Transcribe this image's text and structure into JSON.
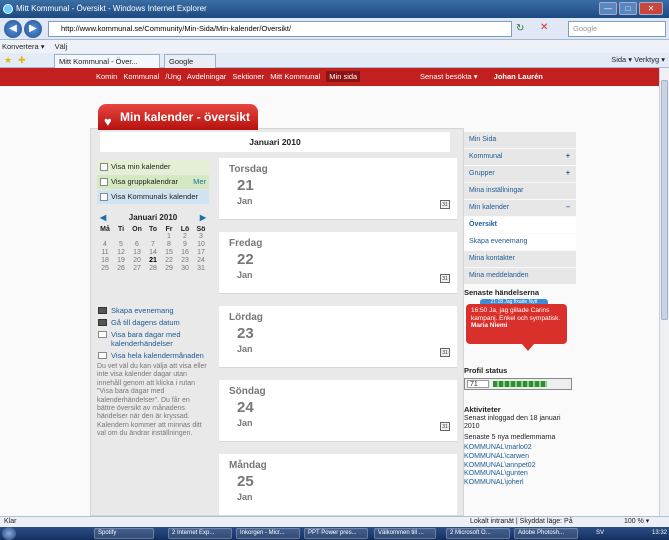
{
  "window": {
    "title": "Mitt Kommunal - Översikt - Windows Internet Explorer",
    "buttons": [
      "—",
      "□",
      "✕"
    ]
  },
  "browser": {
    "address": "http://www.kommunal.se/Community/Min-Sida/Min-kalender/Oversikt/",
    "search_placeholder": "Google",
    "toolbar": [
      "Konvertera ▾",
      "Välj"
    ],
    "tabs": [
      "Mitt Kommunal - Över...",
      "Google"
    ],
    "commands": "Sida ▾  Verktyg ▾"
  },
  "topnav": {
    "items": [
      "Komin",
      "Kommunal",
      "/Ung",
      "Avdelningar",
      "Sektioner",
      "Mitt Kommunal",
      "Min sida"
    ],
    "recent": "Senast besökta ▾",
    "user": "Johan Laurén"
  },
  "heading": "Min kalender - översikt",
  "month_title": "Januari 2010",
  "views": [
    {
      "label": "Visa min kalender",
      "extra": ""
    },
    {
      "label": "Visa gruppkalendrar",
      "extra": "Mer"
    },
    {
      "label": "Visa Kommunals kalender",
      "extra": ""
    }
  ],
  "minical": {
    "month": "Januari 2010",
    "days": [
      "Må",
      "Ti",
      "On",
      "To",
      "Fr",
      "Lö",
      "Sö"
    ],
    "cells": [
      "",
      "",
      "",
      "",
      "1",
      "2",
      "3",
      "4",
      "5",
      "6",
      "7",
      "8",
      "9",
      "10",
      "11",
      "12",
      "13",
      "14",
      "15",
      "16",
      "17",
      "18",
      "19",
      "20",
      "21",
      "22",
      "23",
      "24",
      "25",
      "26",
      "27",
      "28",
      "29",
      "30",
      "31"
    ],
    "today": "21"
  },
  "actions": {
    "create": "Skapa evenemang",
    "today": "Gå till dagens datum",
    "only_event_days": "Visa bara dagar med kalenderhändelser",
    "whole_month": "Visa hela kalendermånaden",
    "note": "Du vet väl du kan välja att visa eller inte visa kalender dagar utan innehåll genom att klicka i rutan \"Visa bara dagar med kalenderhändelser\". Du får en bättre översikt av månadens händelser när den är kryssad. Kalendern kommer att minnas ditt val om du ändrar inställningen."
  },
  "days": [
    {
      "name": "Torsdag",
      "num": "21",
      "month": "Jan"
    },
    {
      "name": "Fredag",
      "num": "22",
      "month": "Jan"
    },
    {
      "name": "Lördag",
      "num": "23",
      "month": "Jan"
    },
    {
      "name": "Söndag",
      "num": "24",
      "month": "Jan"
    },
    {
      "name": "Måndag",
      "num": "25",
      "month": "Jan"
    }
  ],
  "day_icon": "31",
  "rightnav": [
    {
      "label": "Min Sida",
      "sign": "",
      "style": ""
    },
    {
      "label": "Kommunal",
      "sign": "+",
      "style": ""
    },
    {
      "label": "Grupper",
      "sign": "+",
      "style": ""
    },
    {
      "label": "Mina inställningar",
      "sign": "",
      "style": ""
    },
    {
      "label": "Min kalender",
      "sign": "–",
      "style": ""
    },
    {
      "label": "Översikt",
      "sign": "",
      "style": "sel"
    },
    {
      "label": "Skapa evenemang",
      "sign": "",
      "style": "sub"
    },
    {
      "label": "Mina kontakter",
      "sign": "",
      "style": ""
    },
    {
      "label": "Mina meddelanden",
      "sign": "",
      "style": ""
    }
  ],
  "events": {
    "title": "Senaste händelserna",
    "back_tab": "21:18 Jag fixade Nytt",
    "text": "16:50 Ja, jag gillade Carins kampanj. Enkel och sympatisk.",
    "author": "Maria Niemi"
  },
  "profile": {
    "title": "Profil status",
    "value": "71",
    "fill": 0.71
  },
  "activities": {
    "title": "Aktiviteter",
    "last_login": "Senast inloggad den 18 januari 2010",
    "members_title": "Senaste 5 nya medlemmarna",
    "members": [
      "KOMMUNAL\\marlo02",
      "KOMMUNAL\\carwen",
      "KOMMUNAL\\annpet02",
      "KOMMUNAL\\gunten",
      "KOMMUNAL\\joherl"
    ]
  },
  "status": {
    "left": "Klar",
    "zone": "Lokalt intranät | Skyddat läge: På",
    "zoom": "100 % ▾"
  },
  "taskbar": {
    "items": [
      "Spotify",
      "2 Internet Exp...",
      "Inkorgen - Micr...",
      "PPT Power pres...",
      "Välkommen till ...",
      "2 Microsoft O...",
      "Adobe Photosh..."
    ],
    "lang": "SV",
    "clock": "13:32"
  }
}
